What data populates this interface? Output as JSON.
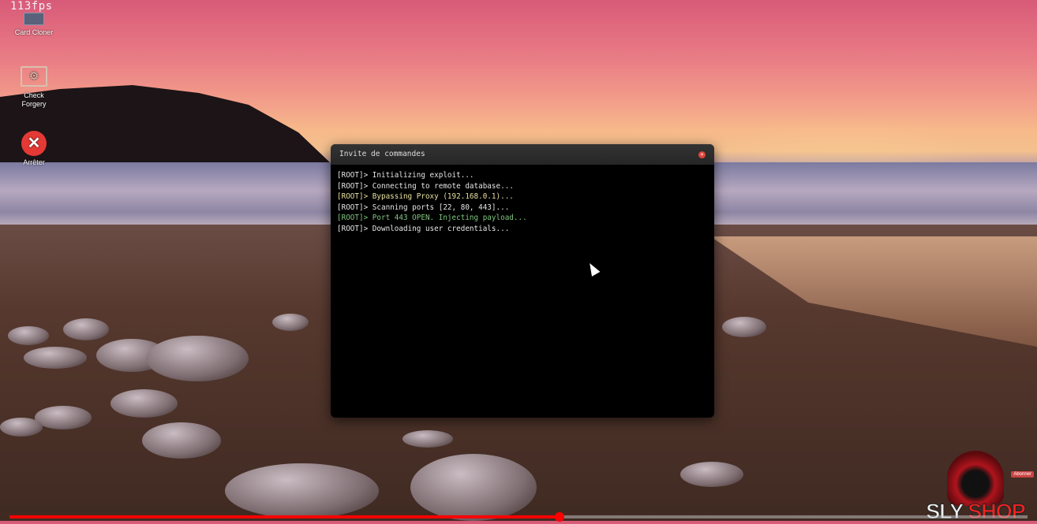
{
  "overlay": {
    "fps": "113fps"
  },
  "desktop": {
    "icons": [
      {
        "label": "Card Cloner",
        "icon": "credit-card-icon"
      },
      {
        "label": "Check Forgery",
        "icon": "gear-monitor-icon"
      },
      {
        "label": "Arrêter",
        "icon": "close-circle-icon"
      }
    ]
  },
  "terminal": {
    "title": "Invite de commandes",
    "lines": [
      {
        "text": "[ROOT]> Initializing exploit...",
        "color": "#e6e6e6"
      },
      {
        "text": "[ROOT]> Connecting to remote database...",
        "color": "#e6e6e6"
      },
      {
        "text": "[ROOT]> Bypassing Proxy (192.168.0.1)...",
        "color": "#e8e0a0"
      },
      {
        "text": "[ROOT]> Scanning ports [22, 80, 443]...",
        "color": "#e6e6e6"
      },
      {
        "text": "[ROOT]> Port 443 OPEN. Injecting payload...",
        "color": "#7fc77f"
      },
      {
        "text": "[ROOT]> Downloading user credentials...",
        "color": "#e6e6e6"
      }
    ]
  },
  "watermark": {
    "sly": "SLY",
    "shop": "SHOP",
    "badge": "Abonner"
  },
  "video": {
    "progress_percent": 54,
    "accent": "#ff0000"
  }
}
